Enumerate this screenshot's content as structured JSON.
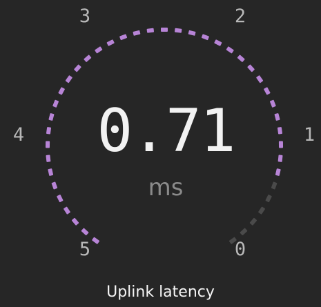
{
  "gauge": {
    "title": "Uplink latency",
    "value": "0.71",
    "unit": "ms",
    "scale_labels": [
      "0",
      "1",
      "2",
      "3",
      "4",
      "5"
    ],
    "scale_min": 5,
    "scale_max": 0,
    "fill_fraction": 0.858,
    "active_color": "#b784d6",
    "inactive_color": "#4a4a4a"
  }
}
